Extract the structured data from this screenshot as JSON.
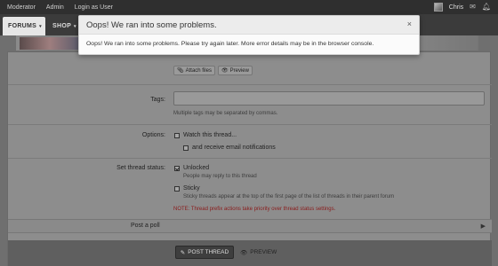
{
  "topbar": {
    "links": [
      "Moderator",
      "Admin",
      "Login as User"
    ],
    "username": "Chris",
    "icons": [
      "avatar",
      "envelope-icon",
      "bell-icon"
    ]
  },
  "nav": {
    "tabs": [
      {
        "label": "FORUMS",
        "active": true
      },
      {
        "label": "SHOP",
        "active": false
      }
    ]
  },
  "editor": {
    "attach_label": "Attach files",
    "preview_label": "Preview"
  },
  "tags": {
    "label": "Tags:",
    "value": "",
    "hint": "Multiple tags may be separated by commas."
  },
  "options": {
    "label": "Options:",
    "watch_label": "Watch this thread...",
    "watch_checked": false,
    "email_label": "and receive email notifications",
    "email_checked": false
  },
  "status": {
    "label": "Set thread status:",
    "unlocked_label": "Unlocked",
    "unlocked_checked": true,
    "unlocked_hint": "People may reply to this thread",
    "sticky_label": "Sticky",
    "sticky_checked": false,
    "sticky_hint": "Sticky threads appear at the top of the first page of the list of threads in their parent forum",
    "note": "NOTE: Thread prefix actions take priority over thread status settings."
  },
  "poll": {
    "label": "Post a poll"
  },
  "actions": {
    "post_label": "POST THREAD",
    "preview_label": "PREVIEW"
  },
  "modal": {
    "title": "Oops! We ran into some problems.",
    "message": "Oops! We ran into some problems. Please try again later. More error details may be in the browser console.",
    "close_glyph": "×"
  },
  "colors": {
    "modal_bg": "#fbfbfb",
    "overlay": "#777777",
    "note": "#8a1a1a",
    "post_button": "#3e3e3e"
  }
}
